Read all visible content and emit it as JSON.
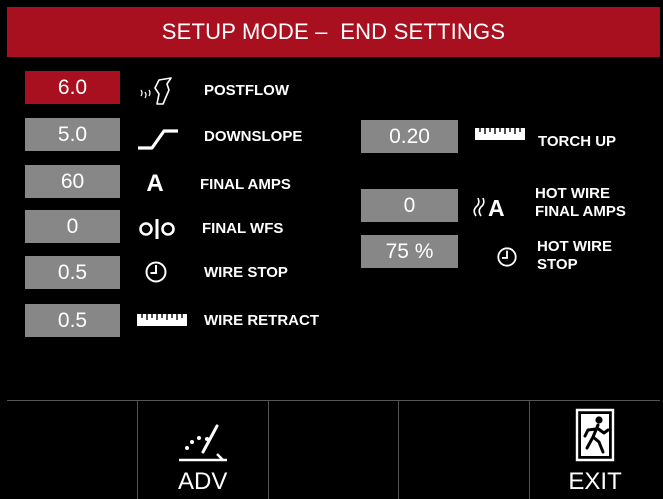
{
  "header": {
    "title": "SETUP MODE –  END SETTINGS"
  },
  "left_params": [
    {
      "value": "6.0",
      "label": "POSTFLOW",
      "icon": "postflow-icon",
      "selected": true
    },
    {
      "value": "5.0",
      "label": "DOWNSLOPE",
      "icon": "downslope-icon"
    },
    {
      "value": "60",
      "label": "FINAL AMPS",
      "icon": "amps-icon"
    },
    {
      "value": "0",
      "label": "FINAL WFS",
      "icon": "wire-feed-speed-icon"
    },
    {
      "value": "0.5",
      "label": "WIRE STOP",
      "icon": "clock-icon"
    },
    {
      "value": "0.5",
      "label": "WIRE RETRACT",
      "icon": "ruler-icon"
    }
  ],
  "right_params": [
    {
      "value": "0.20",
      "label": "TORCH UP",
      "icon": "ruler-icon"
    },
    {
      "value": "0",
      "label_line1": "HOT WIRE",
      "label_line2": "FINAL AMPS",
      "icon": "hot-wire-amps-icon"
    },
    {
      "value": "75 %",
      "label_line1": "HOT WIRE",
      "label_line2": "STOP",
      "icon": "clock-icon"
    }
  ],
  "softkeys": {
    "adv_label": "ADV",
    "exit_label": "EXIT"
  },
  "colors": {
    "accent": "#a8101f",
    "field": "#878787",
    "background": "#000000"
  }
}
